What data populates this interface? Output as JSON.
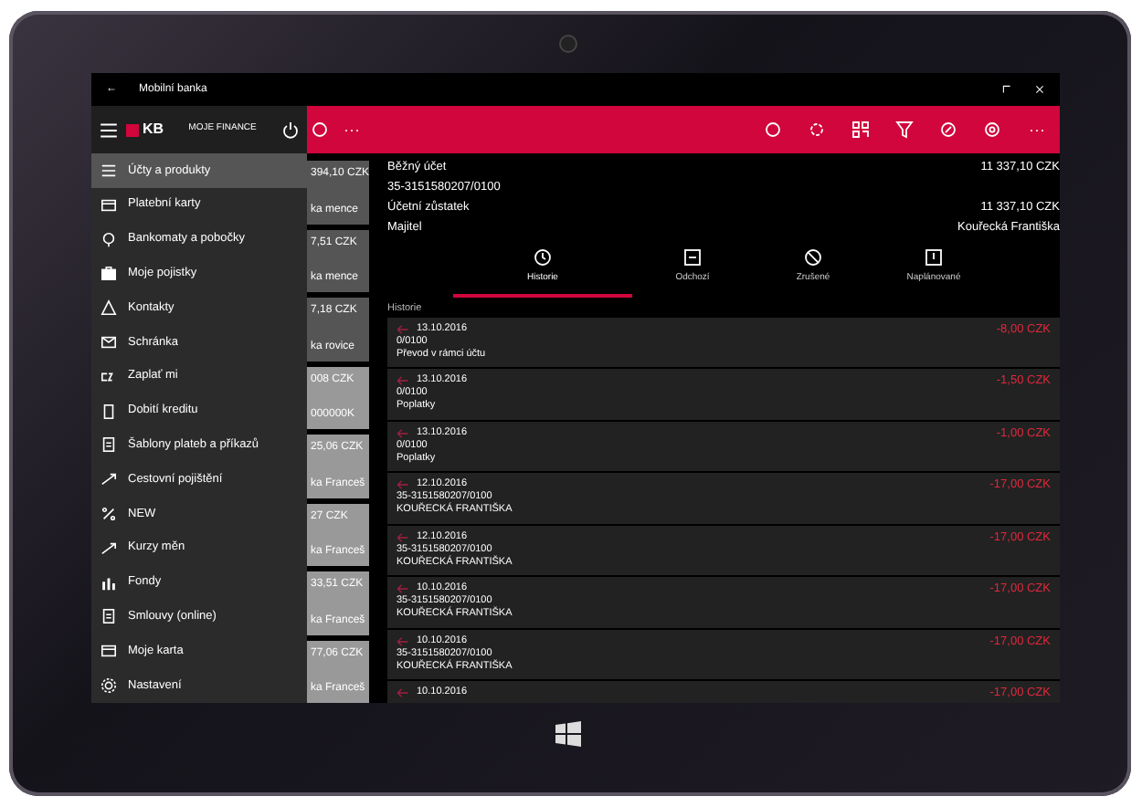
{
  "window": {
    "back": "←",
    "title": "Mobilní banka"
  },
  "menu": {
    "logo": "KB",
    "title": "MOJE FINANCE",
    "items": [
      {
        "label": "Účty a produkty",
        "selected": true
      },
      {
        "label": "Platební karty",
        "selected": false
      },
      {
        "label": "Bankomaty a pobočky",
        "selected": false
      },
      {
        "label": "Moje pojistky",
        "selected": false
      },
      {
        "label": "Kontakty",
        "selected": false
      },
      {
        "label": "Schránka",
        "selected": false
      },
      {
        "label": "Zaplať mi",
        "selected": false
      },
      {
        "label": "Dobití kreditu",
        "selected": false
      },
      {
        "label": "Šablony plateb a příkazů",
        "selected": false
      },
      {
        "label": "Cestovní pojištění",
        "selected": false
      },
      {
        "label": "NEW",
        "selected": false
      },
      {
        "label": "Kurzy měn",
        "selected": false
      },
      {
        "label": "Fondy",
        "selected": false
      },
      {
        "label": "Smlouvy (online)",
        "selected": false
      },
      {
        "label": "Moje karta",
        "selected": false
      },
      {
        "label": "Nastavení",
        "selected": false
      }
    ]
  },
  "account_tiles": [
    {
      "amount": "394,10 CZK",
      "note": "ka mence"
    },
    {
      "amount": "7,51 CZK",
      "note": "ka mence"
    },
    {
      "amount": "7,18 CZK",
      "note": "ka rovice"
    },
    {
      "amount": "008 CZK",
      "note": "000000K"
    },
    {
      "amount": "25,06 CZK",
      "note": "ka Franceš"
    },
    {
      "amount": "27 CZK",
      "note": "ka Franceš"
    },
    {
      "amount": "33,51 CZK",
      "note": "ka Franceš"
    },
    {
      "amount": "77,06 CZK",
      "note": "ka Franceš"
    }
  ],
  "account": {
    "name": "Běžný účet",
    "balance": "11 337,10 CZK",
    "number": "35-3151580207/0100",
    "book_label": "Účetní zůstatek",
    "book_balance": "11 337,10 CZK",
    "owner_label": "Majitel",
    "owner": "Kouřecká Františka"
  },
  "tabs": [
    {
      "label": "Historie",
      "selected": true
    },
    {
      "label": "Odchozí",
      "selected": false
    },
    {
      "label": "Zrušené",
      "selected": false
    },
    {
      "label": "Naplánované",
      "selected": false
    }
  ],
  "section": "Historie",
  "transactions": [
    {
      "date": "13.10.2016",
      "account": "0/0100",
      "description": "Převod v rámci účtu",
      "amount": "-8,00 CZK"
    },
    {
      "date": "13.10.2016",
      "account": "0/0100",
      "description": "Poplatky",
      "amount": "-1,50 CZK"
    },
    {
      "date": "13.10.2016",
      "account": "0/0100",
      "description": "Poplatky",
      "amount": "-1,00 CZK"
    },
    {
      "date": "12.10.2016",
      "account": "35-3151580207/0100",
      "description": "KOUŘECKÁ FRANTIŠKA",
      "amount": "-17,00 CZK"
    },
    {
      "date": "12.10.2016",
      "account": "35-3151580207/0100",
      "description": "KOUŘECKÁ FRANTIŠKA",
      "amount": "-17,00 CZK"
    },
    {
      "date": "10.10.2016",
      "account": "35-3151580207/0100",
      "description": "KOUŘECKÁ FRANTIŠKA",
      "amount": "-17,00 CZK"
    },
    {
      "date": "10.10.2016",
      "account": "35-3151580207/0100",
      "description": "KOUŘECKÁ FRANTIŠKA",
      "amount": "-17,00 CZK"
    },
    {
      "date": "10.10.2016",
      "amount": "-17,00 CZK"
    }
  ],
  "more": "···",
  "more_left": "···"
}
